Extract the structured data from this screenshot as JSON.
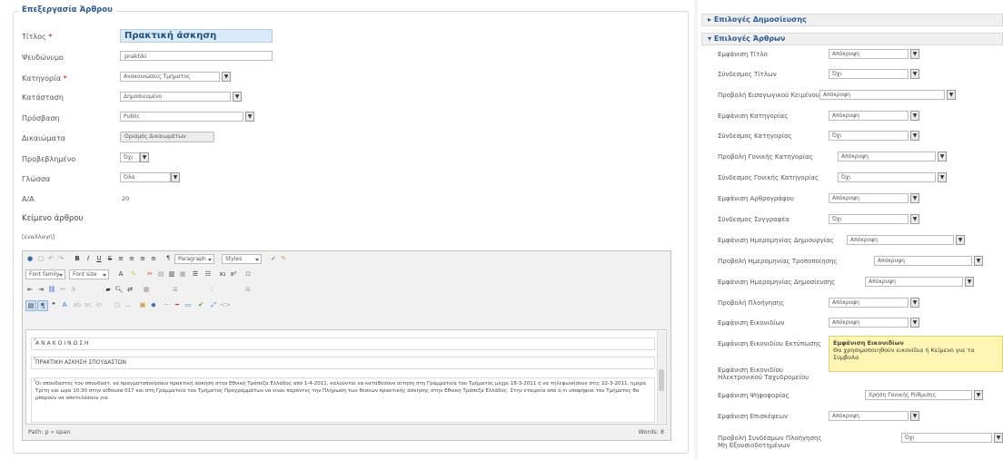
{
  "left": {
    "legend": "Επεξεργασία Άρθρου",
    "title_label": "Τίτλος",
    "title_value": "Πρακτική άσκηση",
    "alias_label": "Ψευδώνυμο",
    "alias_value": "praktiki",
    "category_label": "Κατηγορία",
    "category_value": "Ανακοινώσεις Τμήματος",
    "state_label": "Κατάσταση",
    "state_value": "Δημοσιευμένο",
    "access_label": "Πρόσβαση",
    "access_value": "Public",
    "permissions_label": "Δικαιώματα",
    "permissions_button": "Ορισμός Δικαιωμάτων",
    "featured_label": "Προβεβλημένο",
    "featured_value": "Όχι",
    "language_label": "Γλώσσα",
    "language_value": "Όλα",
    "id_label": "Α/Α",
    "id_value": "20",
    "article_text_label": "Κείμενο άρθρου",
    "toggle_editor": "[εναλλαγή]"
  },
  "editor": {
    "format_select": "Paragraph",
    "styles_select": "Styles",
    "font_family_select": "Font family",
    "font_size_select": "Font size",
    "para1": "ΑΝΑΚΟΙΝΩΣΗ",
    "para2": "ΠΡΑΚΤΙΚΗ ΑΣΚΗΣΗ ΣΠΟΥΔΑΣΤΩΝ",
    "para3": "Οι σπουδαστές του σπουδαστ. να πραγματοποιήσουν πρακτική άσκηση στην Εθνική Τράπεζα Ελλάδος από 1-4-2011, καλούνται να καταθέσουν αίτηση στη Γραμματεία του Τμήματος μέχρι 18-3-2011 ή να τηλεφωνήσουν στις 22-3-2011, ημέρα Τρίτη και ώρα 10:30 στην αίθουσα 017 και στη Γραμματεία του Τμήματος Προγραμμάτων να είναι παρόντες την Πλήρωση των θέσεων πρακτικής άσκησης στην Εθνική Τράπεζα Ελλάδος. Στην εταιρεία από ό,τι υποψήφιοι του Τμήματος θα μπορούν να αποτελέσουν για",
    "path_text": "Path: p » span",
    "words_text": "Words: 8"
  },
  "right": {
    "section1": "Επιλογές Δημοσίευσης",
    "section2": "Επιλογές Άρθρων",
    "rows": [
      {
        "label": "Εμφάνιση Τίτλο",
        "value": "Απόκρυψη"
      },
      {
        "label": "Σύνδεσμος Τίτλων",
        "value": "Όχι"
      },
      {
        "label": "Προβολή Εισαγωγικού Κειμένου",
        "value": "Απόκρυψη"
      },
      {
        "label": "Εμφάνιση Κατηγορίας",
        "value": "Απόκρυψη"
      },
      {
        "label": "Σύνδεσμος Κατηγορίας",
        "value": "Όχι"
      },
      {
        "label": "Προβολή Γονικής Κατηγορίας",
        "value": "Απόκρυψη"
      },
      {
        "label": "Σύνδεσμος Γονικής Κατηγορίας",
        "value": "Όχι"
      },
      {
        "label": "Εμφάνιση Αρθρογράφου",
        "value": "Απόκρυψη"
      },
      {
        "label": "Σύνδεσμος Συγγραφέα",
        "value": "Όχι"
      },
      {
        "label": "Εμφάνιση Ημερομηνίας Δημιουργίας",
        "value": "Απόκρυψη"
      },
      {
        "label": "Προβολή Ημερομηνίας Τροποποίησης",
        "value": "Απόκρυψη"
      },
      {
        "label": "Εμφάνιση Ημερομηνίας Δημοσίευσης",
        "value": "Απόκρυψη"
      },
      {
        "label": "Προβολή Πλοήγησης",
        "value": "Απόκρυψη"
      },
      {
        "label": "Εμφάνιση Εικονιδίων",
        "value": "Απόκρυψη"
      },
      {
        "label": "Εμφάνιση Εικονιδίου Εκτύπωσης",
        "value": ""
      },
      {
        "label": "Εμφάνιση Εικονιδίου Ηλεκτρονικού Ταχυδρομείου",
        "value": ""
      },
      {
        "label": "Εμφάνιση Ψηφοφορίας",
        "value": "Χρήση Γονικής Ρύθμισης"
      },
      {
        "label": "Εμφάνιση Επισκέψεων",
        "value": "Απόκρυψη"
      },
      {
        "label": "Προβολή Συνδέσμων Πλοήγησης Μη Εξουσιοδοτημένων",
        "value": "Όχι"
      }
    ],
    "tooltip_title": "Εμφάνιση Εικονιδίων",
    "tooltip_text": "Θα χρησιμοποιηθούν εικονίδια ή Κείμενο για τα Σύμβολα"
  }
}
